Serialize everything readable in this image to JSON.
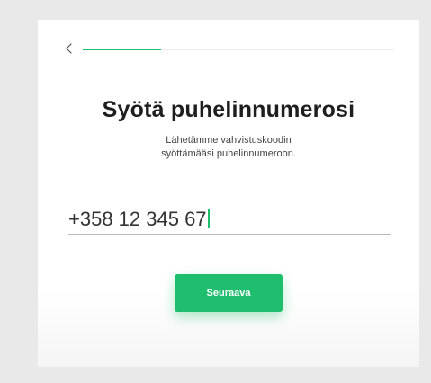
{
  "header": {
    "back_icon": "chevron-left-icon",
    "progress": 0.25
  },
  "title": "Syötä puhelinnumerosi",
  "subtitle": "Lähetämme vahvistuskoodin syöttämääsi puhelinnumeroon.",
  "phone_input": {
    "value": "+358 12 345 67"
  },
  "next_button": {
    "label": "Seuraava"
  },
  "colors": {
    "accent": "#1fbe6e",
    "background": "#e9e9e9",
    "card": "#ffffff",
    "text": "#1e1e1e"
  }
}
